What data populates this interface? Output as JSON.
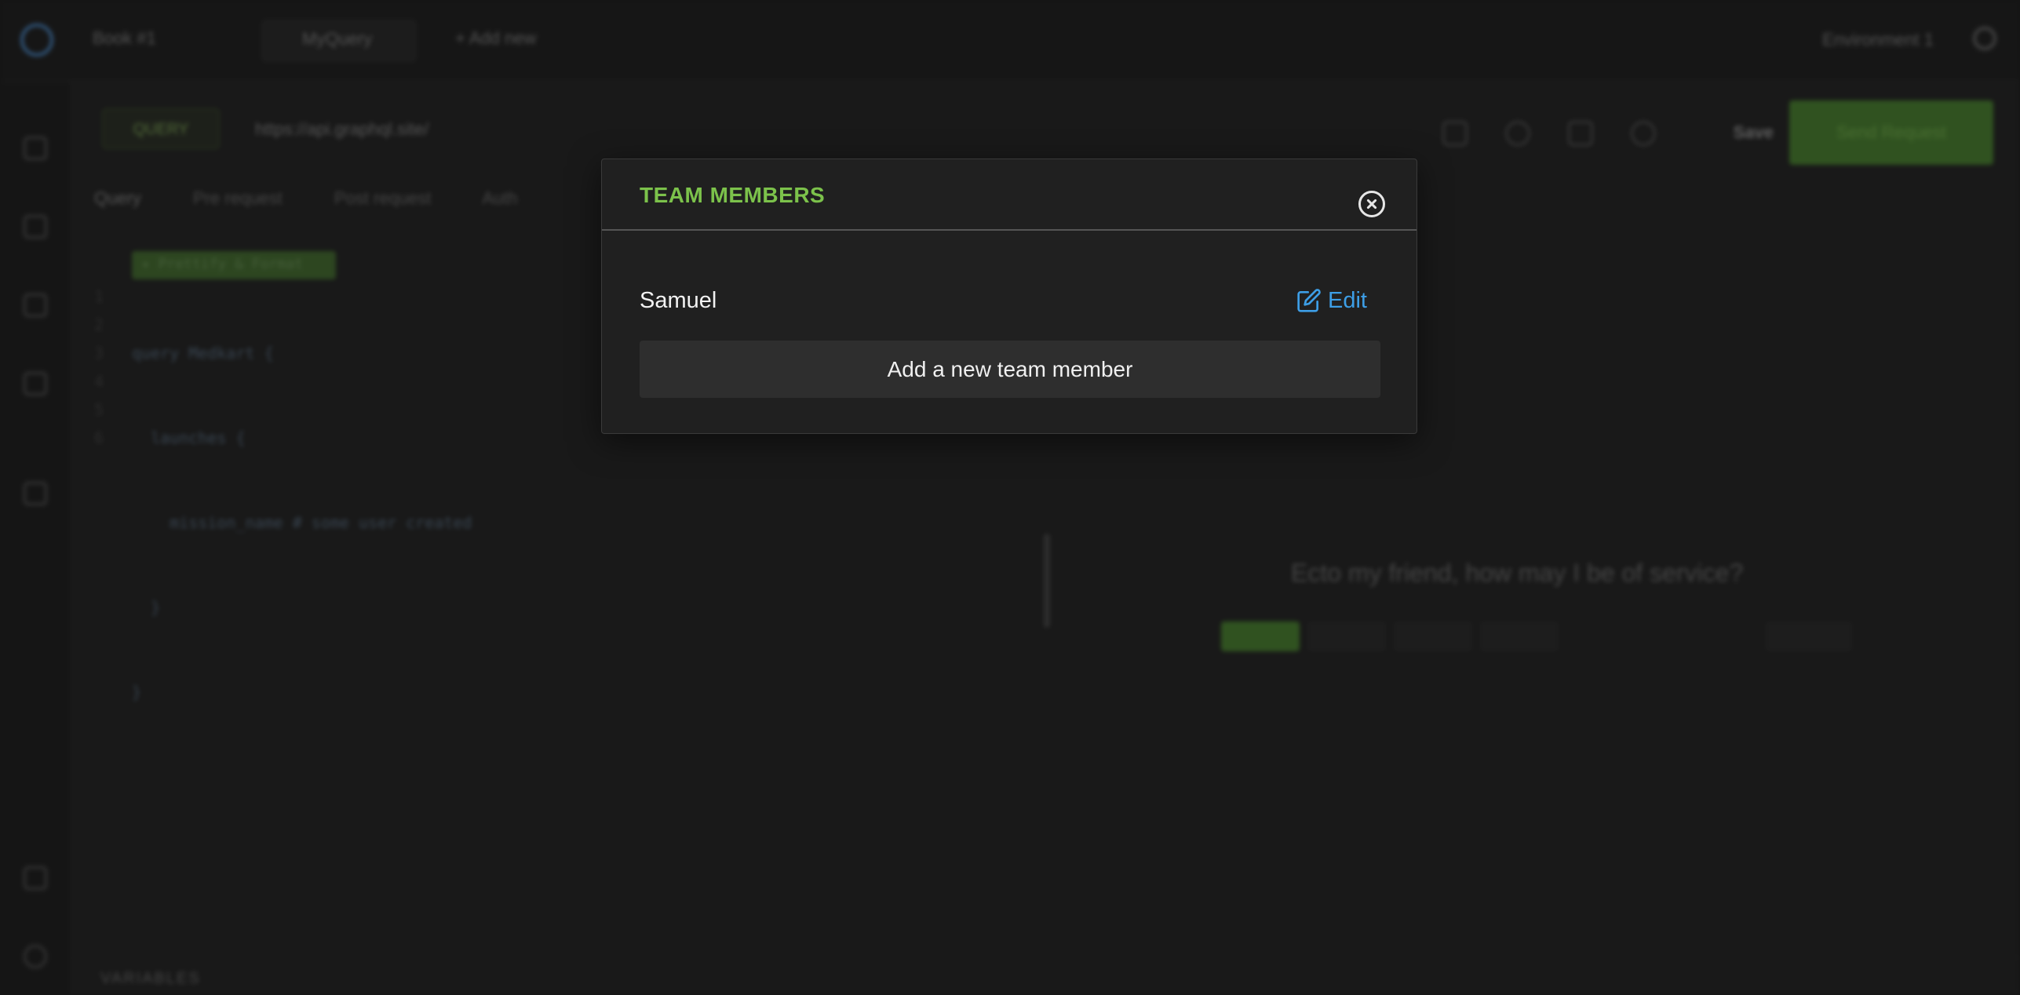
{
  "background": {
    "topbar": {
      "workspace_label": "Book #1",
      "collection_label": "MyQuery",
      "add_new_label": "+ Add new",
      "environment_label": "Environment 1"
    },
    "request": {
      "method": "QUERY",
      "url": "https://api.graphql.site/",
      "save_label": "Save",
      "send_label": "Send Request"
    },
    "tabs": [
      "Query",
      "Pre request",
      "Post request",
      "Auth"
    ],
    "editor": {
      "badge": "✦ Prettify & Format",
      "lines": [
        "query Medkart {",
        "  launches {",
        "    mission_name # some user created",
        "  }",
        "}",
        ""
      ],
      "line_numbers": [
        "1",
        "2",
        "3",
        "4",
        "5",
        "6"
      ]
    },
    "response_placeholder": "Ecto my friend, how may I be of service?",
    "variables_label": "VARIABLES"
  },
  "modal": {
    "title": "TEAM MEMBERS",
    "close_icon": "close-circle-icon",
    "members": [
      {
        "name": "Samuel",
        "edit_label": "Edit"
      }
    ],
    "add_member_label": "Add a new team member",
    "colors": {
      "title": "#7cc24b",
      "edit": "#3d9ee6",
      "background": "#202020",
      "button": "#2e2e2e"
    }
  }
}
